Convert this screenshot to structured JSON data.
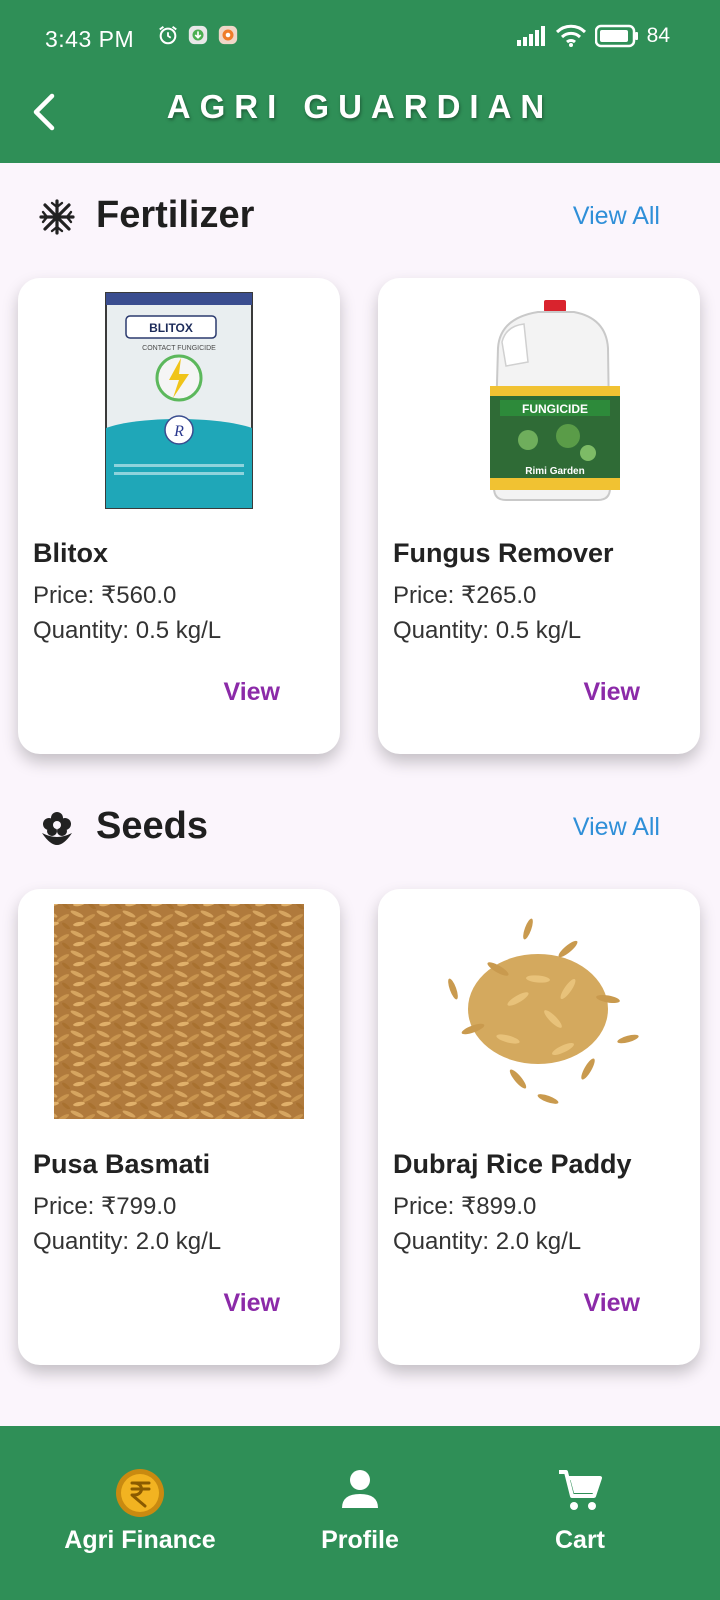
{
  "status_bar": {
    "time": "3:43 PM",
    "battery": "84"
  },
  "app": {
    "title": "AGRI GUARDIAN"
  },
  "sections": [
    {
      "title": "Fertilizer",
      "view_all": "View All",
      "products": [
        {
          "name": "Blitox",
          "price": "Price: ₹560.0",
          "quantity": "Quantity: 0.5 kg/L",
          "action": "View",
          "pack_brand": "BLITOX",
          "pack_sub": "CONTACT FUNGICIDE"
        },
        {
          "name": "Fungus Remover",
          "price": "Price: ₹265.0",
          "quantity": "Quantity: 0.5 kg/L",
          "action": "View",
          "pack_brand": "FUNGICIDE",
          "pack_sub": "Rimi Garden"
        }
      ]
    },
    {
      "title": "Seeds",
      "view_all": "View All",
      "products": [
        {
          "name": "Pusa Basmati",
          "price": "Price: ₹799.0",
          "quantity": "Quantity: 2.0 kg/L",
          "action": "View"
        },
        {
          "name": "Dubraj Rice Paddy",
          "price": "Price: ₹899.0",
          "quantity": "Quantity: 2.0 kg/L",
          "action": "View"
        }
      ]
    }
  ],
  "bottom_nav": [
    {
      "label": "Agri Finance",
      "icon": "rupee-coin-icon"
    },
    {
      "label": "Profile",
      "icon": "person-icon"
    },
    {
      "label": "Cart",
      "icon": "cart-icon"
    }
  ],
  "colors": {
    "primary": "#2f8f57",
    "link": "#2f8fd8",
    "action": "#8b2aa8",
    "background": "#fbf5fc"
  }
}
